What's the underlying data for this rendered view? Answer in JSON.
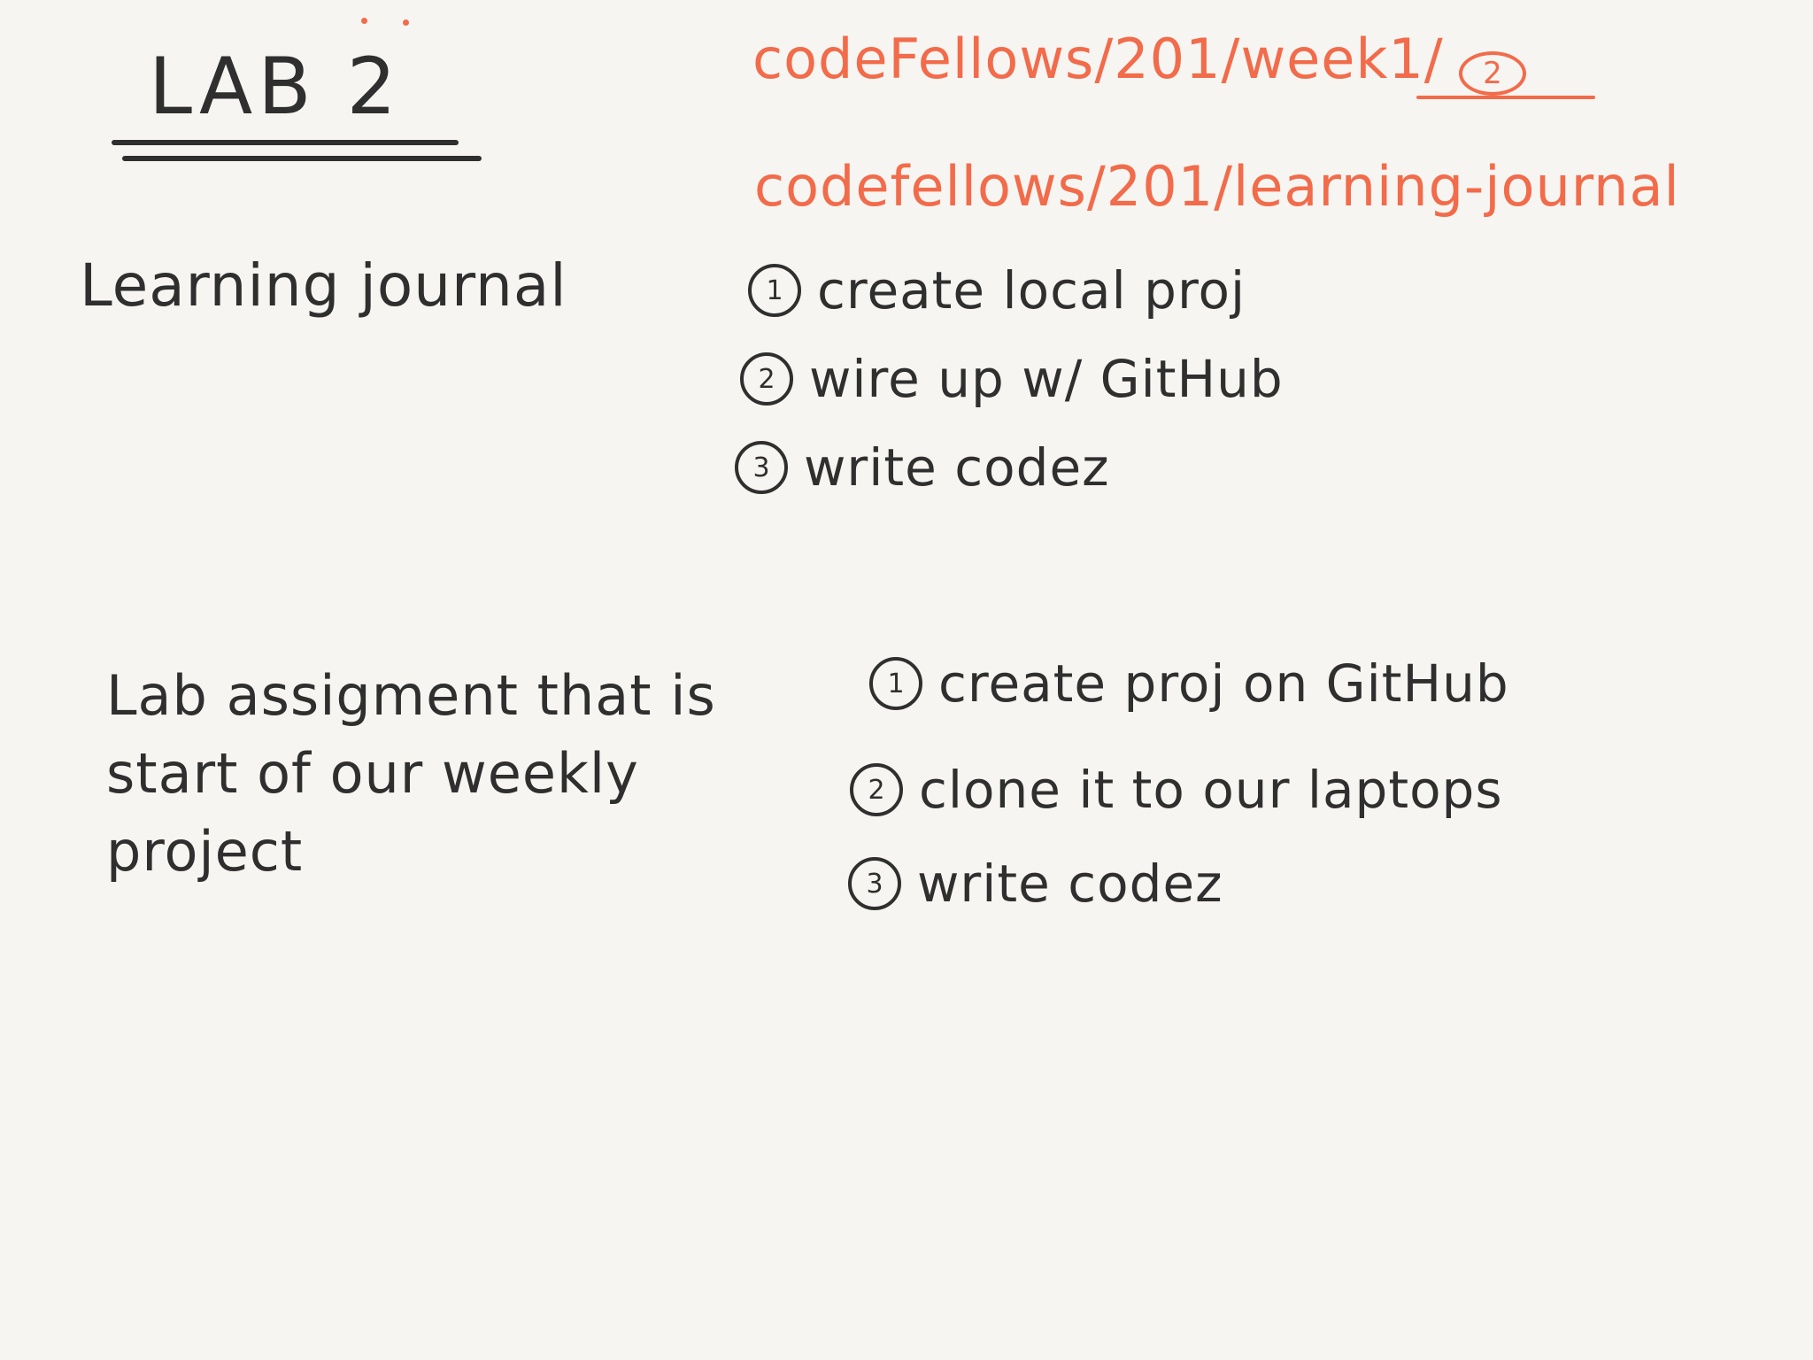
{
  "title": "LAB 2",
  "paths": {
    "week_path": "codeFellows/201/week1/",
    "week_path_circle": "2",
    "journal_path": "codefellows/201/learning-journal"
  },
  "learning_journal": {
    "label": "Learning journal",
    "steps": [
      {
        "num": "1",
        "text": "create local proj"
      },
      {
        "num": "2",
        "text": "wire up w/ GitHub"
      },
      {
        "num": "3",
        "text": "write codez"
      }
    ]
  },
  "lab_assignment": {
    "label": "Lab assigment that is start of our weekly project",
    "steps": [
      {
        "num": "1",
        "text": "create proj on GitHub"
      },
      {
        "num": "2",
        "text": "clone it to our laptops"
      },
      {
        "num": "3",
        "text": "write codez"
      }
    ]
  },
  "colors": {
    "ink": "#2f2f2f",
    "accent": "#f26b4a",
    "paper": "#f6f5f1"
  }
}
